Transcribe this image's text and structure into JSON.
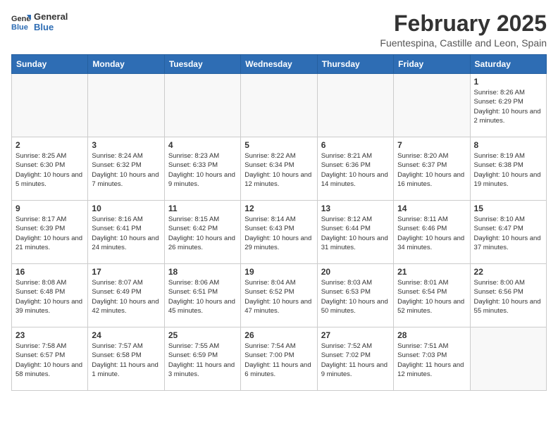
{
  "header": {
    "logo_general": "General",
    "logo_blue": "Blue",
    "month_year": "February 2025",
    "location": "Fuentespina, Castille and Leon, Spain"
  },
  "weekdays": [
    "Sunday",
    "Monday",
    "Tuesday",
    "Wednesday",
    "Thursday",
    "Friday",
    "Saturday"
  ],
  "weeks": [
    [
      {
        "day": "",
        "info": ""
      },
      {
        "day": "",
        "info": ""
      },
      {
        "day": "",
        "info": ""
      },
      {
        "day": "",
        "info": ""
      },
      {
        "day": "",
        "info": ""
      },
      {
        "day": "",
        "info": ""
      },
      {
        "day": "1",
        "info": "Sunrise: 8:26 AM\nSunset: 6:29 PM\nDaylight: 10 hours and 2 minutes."
      }
    ],
    [
      {
        "day": "2",
        "info": "Sunrise: 8:25 AM\nSunset: 6:30 PM\nDaylight: 10 hours and 5 minutes."
      },
      {
        "day": "3",
        "info": "Sunrise: 8:24 AM\nSunset: 6:32 PM\nDaylight: 10 hours and 7 minutes."
      },
      {
        "day": "4",
        "info": "Sunrise: 8:23 AM\nSunset: 6:33 PM\nDaylight: 10 hours and 9 minutes."
      },
      {
        "day": "5",
        "info": "Sunrise: 8:22 AM\nSunset: 6:34 PM\nDaylight: 10 hours and 12 minutes."
      },
      {
        "day": "6",
        "info": "Sunrise: 8:21 AM\nSunset: 6:36 PM\nDaylight: 10 hours and 14 minutes."
      },
      {
        "day": "7",
        "info": "Sunrise: 8:20 AM\nSunset: 6:37 PM\nDaylight: 10 hours and 16 minutes."
      },
      {
        "day": "8",
        "info": "Sunrise: 8:19 AM\nSunset: 6:38 PM\nDaylight: 10 hours and 19 minutes."
      }
    ],
    [
      {
        "day": "9",
        "info": "Sunrise: 8:17 AM\nSunset: 6:39 PM\nDaylight: 10 hours and 21 minutes."
      },
      {
        "day": "10",
        "info": "Sunrise: 8:16 AM\nSunset: 6:41 PM\nDaylight: 10 hours and 24 minutes."
      },
      {
        "day": "11",
        "info": "Sunrise: 8:15 AM\nSunset: 6:42 PM\nDaylight: 10 hours and 26 minutes."
      },
      {
        "day": "12",
        "info": "Sunrise: 8:14 AM\nSunset: 6:43 PM\nDaylight: 10 hours and 29 minutes."
      },
      {
        "day": "13",
        "info": "Sunrise: 8:12 AM\nSunset: 6:44 PM\nDaylight: 10 hours and 31 minutes."
      },
      {
        "day": "14",
        "info": "Sunrise: 8:11 AM\nSunset: 6:46 PM\nDaylight: 10 hours and 34 minutes."
      },
      {
        "day": "15",
        "info": "Sunrise: 8:10 AM\nSunset: 6:47 PM\nDaylight: 10 hours and 37 minutes."
      }
    ],
    [
      {
        "day": "16",
        "info": "Sunrise: 8:08 AM\nSunset: 6:48 PM\nDaylight: 10 hours and 39 minutes."
      },
      {
        "day": "17",
        "info": "Sunrise: 8:07 AM\nSunset: 6:49 PM\nDaylight: 10 hours and 42 minutes."
      },
      {
        "day": "18",
        "info": "Sunrise: 8:06 AM\nSunset: 6:51 PM\nDaylight: 10 hours and 45 minutes."
      },
      {
        "day": "19",
        "info": "Sunrise: 8:04 AM\nSunset: 6:52 PM\nDaylight: 10 hours and 47 minutes."
      },
      {
        "day": "20",
        "info": "Sunrise: 8:03 AM\nSunset: 6:53 PM\nDaylight: 10 hours and 50 minutes."
      },
      {
        "day": "21",
        "info": "Sunrise: 8:01 AM\nSunset: 6:54 PM\nDaylight: 10 hours and 52 minutes."
      },
      {
        "day": "22",
        "info": "Sunrise: 8:00 AM\nSunset: 6:56 PM\nDaylight: 10 hours and 55 minutes."
      }
    ],
    [
      {
        "day": "23",
        "info": "Sunrise: 7:58 AM\nSunset: 6:57 PM\nDaylight: 10 hours and 58 minutes."
      },
      {
        "day": "24",
        "info": "Sunrise: 7:57 AM\nSunset: 6:58 PM\nDaylight: 11 hours and 1 minute."
      },
      {
        "day": "25",
        "info": "Sunrise: 7:55 AM\nSunset: 6:59 PM\nDaylight: 11 hours and 3 minutes."
      },
      {
        "day": "26",
        "info": "Sunrise: 7:54 AM\nSunset: 7:00 PM\nDaylight: 11 hours and 6 minutes."
      },
      {
        "day": "27",
        "info": "Sunrise: 7:52 AM\nSunset: 7:02 PM\nDaylight: 11 hours and 9 minutes."
      },
      {
        "day": "28",
        "info": "Sunrise: 7:51 AM\nSunset: 7:03 PM\nDaylight: 11 hours and 12 minutes."
      },
      {
        "day": "",
        "info": ""
      }
    ]
  ]
}
